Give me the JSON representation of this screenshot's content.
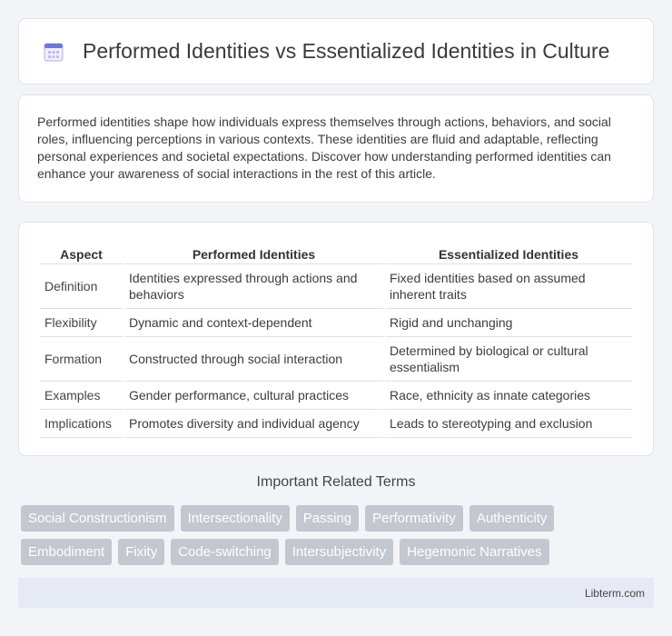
{
  "header": {
    "title": "Performed Identities vs Essentialized Identities in Culture",
    "icon": "calendar-icon"
  },
  "intro": {
    "text": "Performed identities shape how individuals express themselves through actions, behaviors, and social roles, influencing perceptions in various contexts. These identities are fluid and adaptable, reflecting personal experiences and societal expectations. Discover how understanding performed identities can enhance your awareness of social interactions in the rest of this article."
  },
  "table": {
    "headers": [
      "Aspect",
      "Performed Identities",
      "Essentialized Identities"
    ],
    "rows": [
      [
        "Definition",
        "Identities expressed through actions and behaviors",
        "Fixed identities based on assumed inherent traits"
      ],
      [
        "Flexibility",
        "Dynamic and context-dependent",
        "Rigid and unchanging"
      ],
      [
        "Formation",
        "Constructed through social interaction",
        "Determined by biological or cultural essentialism"
      ],
      [
        "Examples",
        "Gender performance, cultural practices",
        "Race, ethnicity as innate categories"
      ],
      [
        "Implications",
        "Promotes diversity and individual agency",
        "Leads to stereotyping and exclusion"
      ]
    ]
  },
  "related": {
    "title": "Important Related Terms",
    "tags": [
      "Social Constructionism",
      "Intersectionality",
      "Passing",
      "Performativity",
      "Authenticity",
      "Embodiment",
      "Fixity",
      "Code-switching",
      "Intersubjectivity",
      "Hegemonic Narratives"
    ]
  },
  "footer": {
    "site": "Libterm.com"
  }
}
